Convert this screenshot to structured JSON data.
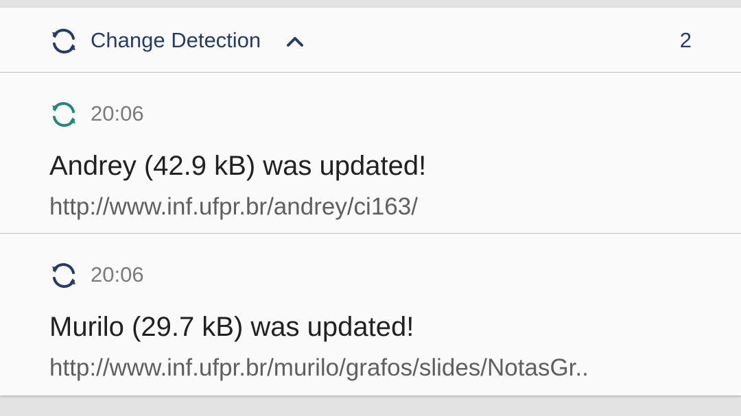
{
  "colors": {
    "header_accent": "#213d6b",
    "first_icon_accent": "#1e8a7a",
    "second_icon_accent": "#213d6b"
  },
  "header": {
    "icon": "sync-icon",
    "title": "Change Detection",
    "chevron_icon": "chevron-up-icon",
    "count": "2"
  },
  "notifications": [
    {
      "icon": "sync-icon",
      "time": "20:06",
      "title": "Andrey (42.9 kB) was updated!",
      "text": "http://www.inf.ufpr.br/andrey/ci163/"
    },
    {
      "icon": "sync-icon",
      "time": "20:06",
      "title": "Murilo (29.7 kB) was updated!",
      "text": "http://www.inf.ufpr.br/murilo/grafos/slides/NotasGr.."
    }
  ]
}
